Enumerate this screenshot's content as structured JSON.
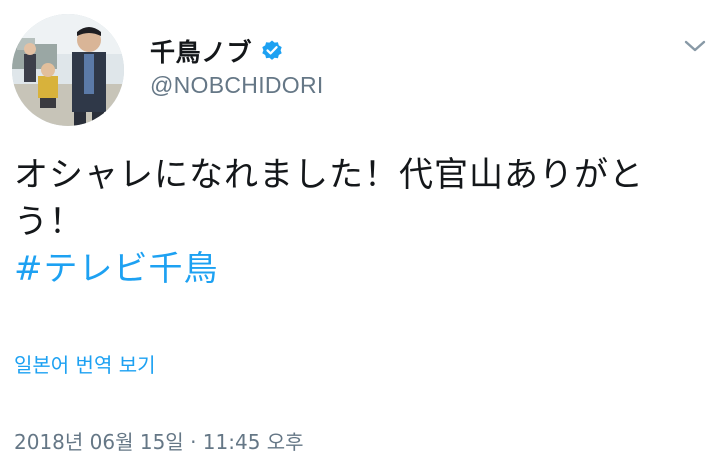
{
  "author": {
    "display_name": "千鳥ノブ",
    "handle": "@NOBCHIDORI",
    "verified_icon": "verified-badge-icon",
    "avatar_icon": "profile-photo"
  },
  "menu": {
    "icon": "chevron-down-icon"
  },
  "tweet": {
    "text_line_1": "オシャレになれました！代官山ありがと",
    "text_line_2": "う！",
    "hashtag": "#テレビ千鳥"
  },
  "translate_label": "일본어 번역 보기",
  "timestamp": "2018년 06월 15일 · 11:45 오후",
  "colors": {
    "link": "#1da1f2",
    "secondary": "#657786",
    "primary": "#14171a"
  }
}
